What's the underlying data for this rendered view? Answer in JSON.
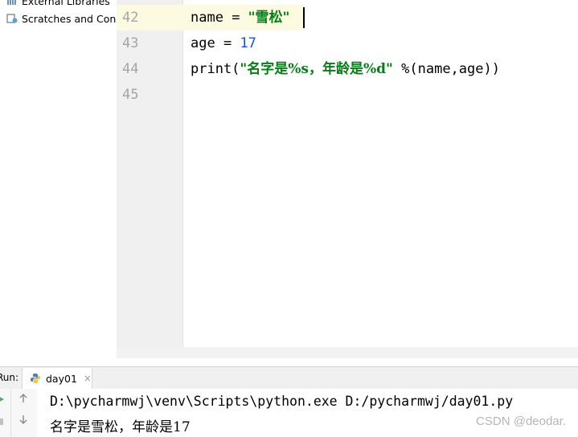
{
  "project_tree": {
    "items": [
      {
        "label": "External Libraries",
        "icon": "library-icon"
      },
      {
        "label": "Scratches and Consoles",
        "icon": "scratches-icon"
      }
    ]
  },
  "editor": {
    "line_numbers": [
      "42",
      "43",
      "44",
      "45"
    ],
    "lines": [
      {
        "var": "name",
        "op": " = ",
        "string": "\"雪松\""
      },
      {
        "var": "age",
        "op": " = ",
        "number": "17"
      },
      {
        "func": "print(",
        "string": "\"名字是%s，年龄是%d\"",
        "rest": " %(name,age))"
      },
      {
        "text": ""
      }
    ],
    "colors": {
      "string": "#067d17",
      "number": "#1750eb",
      "caret_line": "#fcfae1",
      "gutter": "#f0f0f0"
    }
  },
  "run": {
    "label": "Run:",
    "tab_label": "day01",
    "tab_close": "×",
    "output": [
      "D:\\pycharmwj\\venv\\Scripts\\python.exe D:/pycharmwj/day01.py",
      "名字是雪松，年龄是17"
    ]
  },
  "watermark": "CSDN @deodar."
}
